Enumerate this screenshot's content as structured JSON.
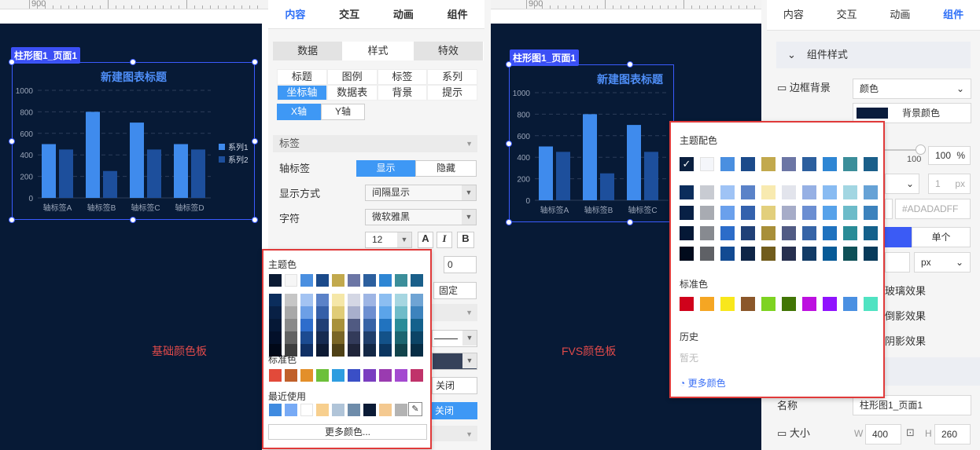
{
  "left_ruler": {
    "label": "900"
  },
  "right_ruler": {
    "label": "900"
  },
  "left_chart": {
    "tag": "柱形图1_页面1",
    "title": "新建图表标题",
    "yticks": [
      "1000",
      "800",
      "600",
      "400",
      "200",
      "0"
    ],
    "categories": [
      "轴标签A",
      "轴标签B",
      "轴标签C",
      "轴标签D"
    ],
    "legend": [
      "系列1",
      "系列2"
    ]
  },
  "chart_data": {
    "type": "bar",
    "title": "新建图表标题",
    "categories": [
      "轴标签A",
      "轴标签B",
      "轴标签C",
      "轴标签D"
    ],
    "series": [
      {
        "name": "系列1",
        "values": [
          500,
          800,
          700,
          500
        ],
        "color": "#3f8bed"
      },
      {
        "name": "系列2",
        "values": [
          450,
          250,
          450,
          450
        ],
        "color": "#1d4f9c"
      }
    ],
    "ylim": [
      0,
      1000
    ],
    "yticks": [
      0,
      200,
      400,
      600,
      800,
      1000
    ],
    "grid": true,
    "legend_position": "right"
  },
  "left_caption": "基础颜色板",
  "left_panel": {
    "tabs": [
      "内容",
      "交互",
      "动画",
      "组件"
    ],
    "subtabs": [
      "数据",
      "样式",
      "特效"
    ],
    "style_grid": [
      "标题",
      "图例",
      "标签",
      "系列",
      "坐标轴",
      "数据表",
      "背景",
      "提示"
    ],
    "axis_buttons": [
      "X轴",
      "Y轴"
    ],
    "section_label": "标签",
    "axis_label": "轴标签",
    "axis_toggle": [
      "显示",
      "隐藏"
    ],
    "display_mode_label": "显示方式",
    "display_mode_value": "间隔显示",
    "font_label": "字符",
    "font_value": "微软雅黑",
    "font_size": "12",
    "bold": "B",
    "italic": "I",
    "text_color": "A",
    "number_value": "0",
    "fixed_label": "固定",
    "close1": "关闭",
    "close2": "关闭"
  },
  "basic_palette": {
    "theme_label": "主题色",
    "standard_label": "标准色",
    "recent_label": "最近使用",
    "more_button": "更多颜色...",
    "theme_top": [
      "#0a1a33",
      "#f6f6f6",
      "#4a8fe0",
      "#1b4a8a",
      "#c2a94d",
      "#6c76a5",
      "#2c5f9e",
      "#2e86d4",
      "#3b8e9a",
      "#1a5f8a"
    ],
    "theme_shades": [
      [
        "#0b2d5c",
        "#c6c6c6",
        "#a3c3f2",
        "#5b82c8",
        "#f5e7a8",
        "#d4d7e4",
        "#9eb5e4",
        "#8cbef1",
        "#a6d6e1",
        "#6fa4d4"
      ],
      [
        "#082045",
        "#a8a8a8",
        "#6c9fe6",
        "#355fa8",
        "#e0cc77",
        "#a8afcc",
        "#6d8fd1",
        "#5ba4e9",
        "#6fbcc9",
        "#3d83bd"
      ],
      [
        "#051836",
        "#8a8a8a",
        "#2e6dcc",
        "#213f75",
        "#a8913a",
        "#505a82",
        "#3763a6",
        "#2173bf",
        "#2a8c98",
        "#14618c"
      ],
      [
        "#03102a",
        "#636363",
        "#1c4b91",
        "#162b51",
        "#7a6626",
        "#333b5a",
        "#213f6b",
        "#135289",
        "#1c6570",
        "#0c4466"
      ],
      [
        "#010818",
        "#3e3e3e",
        "#103064",
        "#0d1a33",
        "#4f4116",
        "#20253a",
        "#142845",
        "#0b3660",
        "#11434b",
        "#072d45"
      ]
    ],
    "standard": [
      "#e24a3a",
      "#c0602a",
      "#e38f2a",
      "#6cc03a",
      "#2e9de0",
      "#3a4fc6",
      "#7a3ec0",
      "#9a3bb0",
      "#a44ad0",
      "#c0336a"
    ],
    "recent": [
      "#3f8be0",
      "#77aaf5",
      "#ffffff",
      "#f7cf8e",
      "#b0c4d8",
      "#6e8caa",
      "#0b1b36",
      "#f4c990",
      "#b3b3b3"
    ]
  },
  "right_chart": {
    "tag": "柱形图1_页面1",
    "title": "新建图表标题",
    "yticks": [
      "1000",
      "800",
      "600",
      "400",
      "200",
      "0"
    ],
    "categories": [
      "轴标签A",
      "轴标签B",
      "轴标签C"
    ]
  },
  "right_caption": "FVS颜色板",
  "right_panel": {
    "tabs": [
      "内容",
      "交互",
      "动画",
      "组件"
    ],
    "section": "组件样式",
    "border_bg_label": "边框背景",
    "border_bg_value": "颜色",
    "bg_color_label": "背景颜色",
    "slider_value": "100",
    "slider_input": "100",
    "percent": "%",
    "px1": "1",
    "px_unit": "px",
    "hex_value": "#ADADADFF",
    "single_label": "单个",
    "px_select": "px",
    "effect1": "玻璃效果",
    "effect2": "倒影效果",
    "effect3": "阴影效果",
    "name_label": "名称",
    "name_value": "柱形图1_页面1",
    "size_label": "大小",
    "w_label": "W",
    "w_value": "400",
    "h_label": "H",
    "h_value": "260"
  },
  "fvs_palette": {
    "theme_label": "主题配色",
    "standard_label": "标准色",
    "history_label": "历史",
    "history_empty": "暂无",
    "more_link": "更多颜色",
    "theme_top": [
      "#0a1f3f",
      "#f4f6fa",
      "#4a8fe0",
      "#1b4a8a",
      "#c2a94d",
      "#6c76a5",
      "#2c5f9e",
      "#2e86d4",
      "#3b8e9a",
      "#1a5f8a"
    ],
    "theme_shades": [
      [
        "#0b2d5c",
        "#c8cbd2",
        "#9fc3f5",
        "#5a82c8",
        "#f8eab0",
        "#e2e4ec",
        "#96b0e4",
        "#88bbf2",
        "#a2d6e2",
        "#66a2d6"
      ],
      [
        "#082045",
        "#a8abb2",
        "#6aa0ec",
        "#3361ad",
        "#e2cf7c",
        "#a6acc8",
        "#6b8ed2",
        "#57a2ea",
        "#6cbbc9",
        "#3c82bd"
      ],
      [
        "#051836",
        "#878a90",
        "#2c6cc9",
        "#204077",
        "#a88f39",
        "#515b84",
        "#3664a7",
        "#1f72bf",
        "#298c97",
        "#14618c"
      ],
      [
        "#010b1c",
        "#5f6166",
        "#124a92",
        "#0e2547",
        "#715c1c",
        "#27304f",
        "#123b66",
        "#075a97",
        "#0e5057",
        "#073a5a"
      ]
    ],
    "standard": [
      "#d0021b",
      "#f5a623",
      "#f8e71c",
      "#8b572a",
      "#7ed321",
      "#417505",
      "#bd10e0",
      "#9013fe",
      "#4a90e2",
      "#50e3c2"
    ]
  }
}
